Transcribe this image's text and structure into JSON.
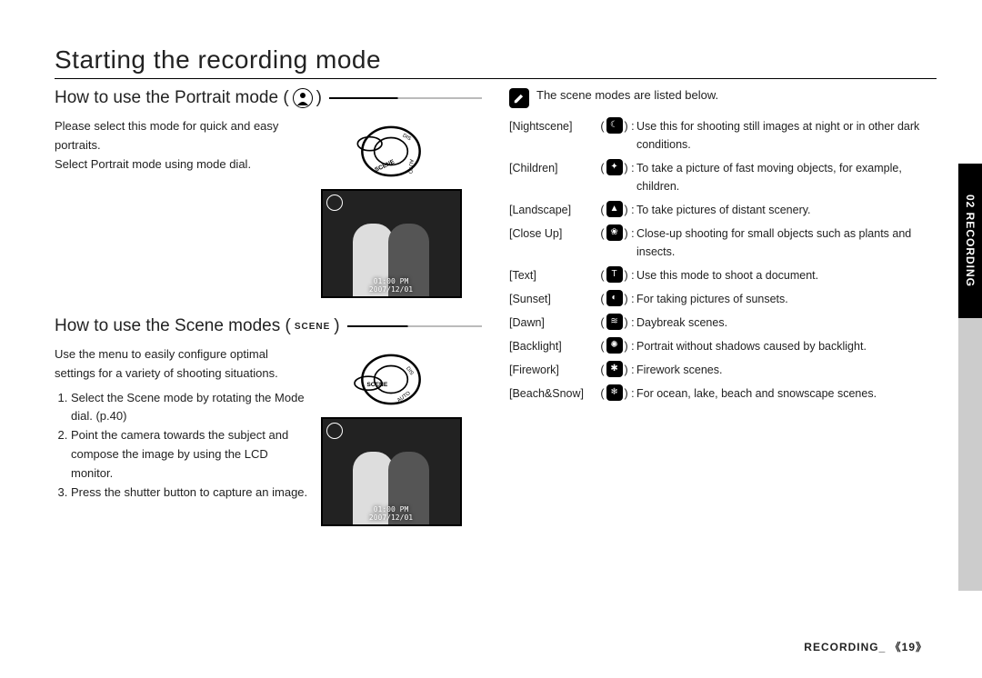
{
  "title": "Starting the recording mode",
  "section1": {
    "heading": "How to use the Portrait mode (",
    "heading_close": ")",
    "icon_sym": "➊",
    "body1": "Please select this mode for quick and easy portraits.",
    "body2": "Select Portrait mode using mode dial.",
    "timestamp_line1": "01:00 PM",
    "timestamp_line2": "2007/12/01"
  },
  "section2": {
    "heading": "How to use the Scene modes (",
    "heading_close": ")",
    "scene_label": "SCENE",
    "body_intro": "Use the menu to easily configure optimal settings for a variety of shooting situations.",
    "step1": "Select the Scene mode by rotating the Mode dial. (p.40)",
    "step2": "Point the camera towards the subject and compose the image by using the LCD monitor.",
    "step3": "Press the shutter button to capture an image.",
    "timestamp_line1": "01:00 PM",
    "timestamp_line2": "2007/12/01"
  },
  "note_intro": "The scene modes are listed below.",
  "scenes": [
    {
      "name": "[Nightscene]",
      "icon": "☾",
      "desc": "Use this for shooting still images at night or in other dark conditions."
    },
    {
      "name": "[Children]",
      "icon": "✦",
      "desc": "To take a picture of fast moving objects, for example, children."
    },
    {
      "name": "[Landscape]",
      "icon": "▲",
      "desc": "To take pictures of distant scenery."
    },
    {
      "name": "[Close Up]",
      "icon": "❀",
      "desc": "Close-up shooting for small objects such as plants and insects."
    },
    {
      "name": "[Text]",
      "icon": "T",
      "desc": "Use this mode to shoot a document."
    },
    {
      "name": "[Sunset]",
      "icon": "◐",
      "desc": "For taking pictures of sunsets."
    },
    {
      "name": "[Dawn]",
      "icon": "≋",
      "desc": "Daybreak scenes."
    },
    {
      "name": "[Backlight]",
      "icon": "✺",
      "desc": "Portrait without shadows caused by backlight."
    },
    {
      "name": "[Firework]",
      "icon": "✱",
      "desc": "Firework scenes."
    },
    {
      "name": "[Beach&Snow]",
      "icon": "❄",
      "desc": "For ocean, lake, beach and snowscape scenes."
    }
  ],
  "side_tab": "02 RECORDING",
  "footer_section": "RECORDING_",
  "footer_page": "《19》"
}
